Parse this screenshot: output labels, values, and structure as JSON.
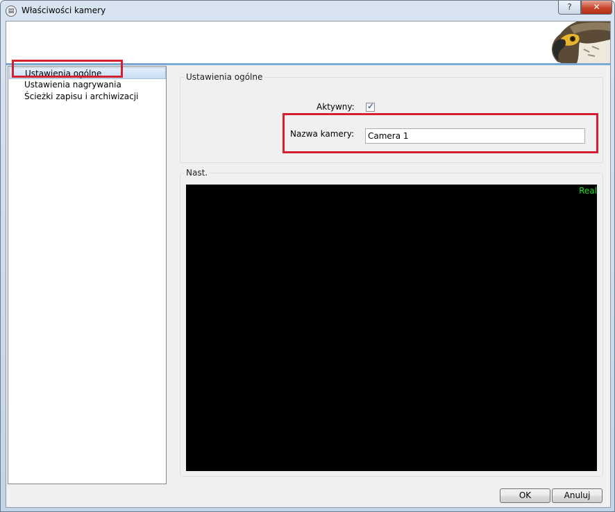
{
  "window": {
    "title": "Właściwości kamery",
    "help_label": "?",
    "close_label": "✕"
  },
  "nav": {
    "items": [
      {
        "label": "Ustawienia ogólne",
        "selected": true
      },
      {
        "label": "Ustawienia nagrywania",
        "selected": false
      },
      {
        "label": "Ścieżki zapisu i archiwizacji",
        "selected": false
      }
    ]
  },
  "general": {
    "group_title": "Ustawienia ogólne",
    "active_label": "Aktywny:",
    "active_checked": true,
    "camera_name_label": "Nazwa kamery:",
    "camera_name_value": "Camera 1"
  },
  "preview": {
    "group_title": "Nast.",
    "overlay_text": "Real"
  },
  "buttons": {
    "ok_label": "OK",
    "cancel_label": "Anuluj"
  },
  "colors": {
    "highlight": "#d2202f",
    "header_line": "#79a9d4",
    "overlay_text": "#1be01b"
  }
}
